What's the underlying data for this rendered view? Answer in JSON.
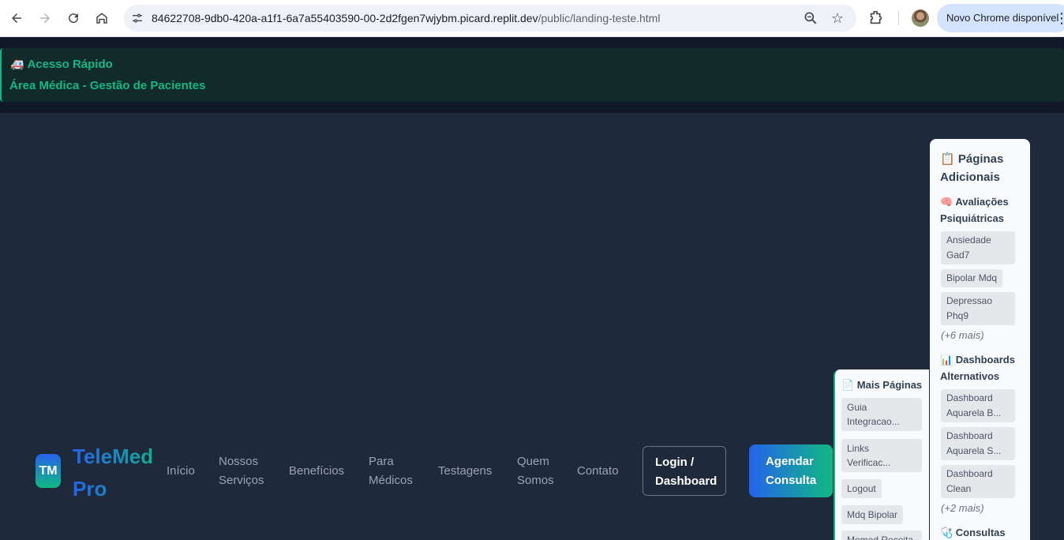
{
  "browser": {
    "url_host": "84622708-9db0-420a-a1f1-6a7a55403590-00-2d2fgen7wjybm.picard.replit.dev",
    "url_path": "/public/landing-teste.html",
    "update_chip": "Novo Chrome disponível"
  },
  "quick_access": {
    "icon": "🚑",
    "title": "Acesso Rápido",
    "link": "Área Médica - Gestão de Pacientes"
  },
  "header": {
    "logo_badge": "TM",
    "logo_line1": "TeleMed",
    "logo_line2": "Pro",
    "nav": [
      {
        "line1": "Início",
        "line2": ""
      },
      {
        "line1": "Nossos",
        "line2": "Serviços"
      },
      {
        "line1": "Benefícios",
        "line2": ""
      },
      {
        "line1": "Para",
        "line2": "Médicos"
      },
      {
        "line1": "Testagens",
        "line2": ""
      },
      {
        "line1": "Quem",
        "line2": "Somos"
      },
      {
        "line1": "Contato",
        "line2": ""
      }
    ],
    "login_line1": "Login /",
    "login_line2": "Dashboard",
    "cta_line1": "Agendar",
    "cta_line2": "Consulta"
  },
  "extra_pages": {
    "title_line1": "📋 Páginas",
    "title_line2": "Adicionais",
    "sections": [
      {
        "title_line1": "🧠 Avaliações",
        "title_line2": "Psiquiátricas",
        "items": [
          {
            "line1": "Ansiedade",
            "line2": "Gad7"
          },
          {
            "line1": "Bipolar Mdq",
            "line2": ""
          },
          {
            "line1": "Depressao",
            "line2": "Phq9"
          }
        ],
        "more": "(+6 mais)"
      },
      {
        "title_line1": "📊 Dashboards",
        "title_line2": "Alternativos",
        "items": [
          {
            "line1": "Dashboard",
            "line2": "Aquarela B..."
          },
          {
            "line1": "Dashboard",
            "line2": "Aquarela S..."
          },
          {
            "line1": "Dashboard",
            "line2": "Clean"
          }
        ],
        "more": "(+2 mais)"
      },
      {
        "title_line1": "🩺 Consultas",
        "title_line2": "",
        "items": [],
        "more": ""
      }
    ]
  },
  "more_pages": {
    "title": "📄 Mais Páginas",
    "items": [
      {
        "line1": "Guia",
        "line2": "Integracao..."
      },
      {
        "line1": "Links",
        "line2": "Verificac..."
      },
      {
        "line1": "Logout",
        "line2": ""
      },
      {
        "line1": "Mdq Bipolar",
        "line2": ""
      },
      {
        "line1": "Memed Receita",
        "line2": ""
      }
    ]
  },
  "colors": {
    "accent_green": "#10b981",
    "accent_blue": "#2563eb",
    "page_bg": "#1e293b"
  }
}
